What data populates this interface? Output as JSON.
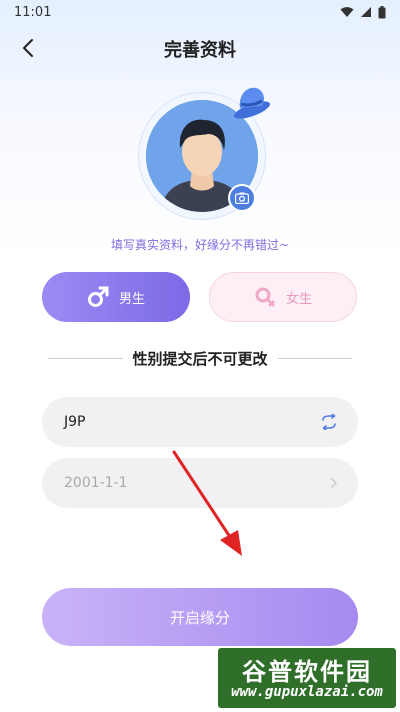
{
  "status_bar": {
    "time": "11:01"
  },
  "header": {
    "title": "完善资料",
    "back_icon": "chevron-left-icon"
  },
  "avatar": {
    "hat_icon": "bowler-hat-icon",
    "camera_icon": "camera-icon"
  },
  "hint": "填写真实资料，好缘分不再错过~",
  "gender": {
    "male_label": "男生",
    "female_label": "女生",
    "selected": "male",
    "male_color": "#7c6ae6",
    "female_color": "#e99ab9"
  },
  "notice": "性别提交后不可更改",
  "form": {
    "nickname_value": "J9P",
    "refresh_icon": "refresh-icon",
    "birthday_value": "2001-1-1",
    "chevron_icon": "chevron-right-icon"
  },
  "submit": {
    "label": "开启缘分"
  },
  "watermark": {
    "title": "谷普软件园",
    "url": "www.gupuxlazai.com"
  },
  "colors": {
    "accent": "#7c6ae6",
    "hint": "#7d6ee0",
    "arrow": "#e02424"
  }
}
